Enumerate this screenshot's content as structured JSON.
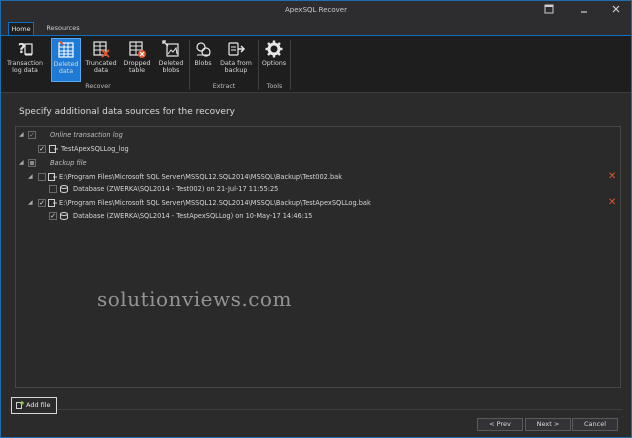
{
  "window": {
    "title": "ApexSQL Recover"
  },
  "tabs": [
    {
      "label": "Home",
      "active": true
    },
    {
      "label": "Resources",
      "active": false
    }
  ],
  "ribbon": {
    "groups": [
      {
        "label": "Recover"
      },
      {
        "label": "Extract"
      },
      {
        "label": "Tools"
      }
    ],
    "buttons": {
      "transaction_log": {
        "line1": "Transaction",
        "line2": "log data"
      },
      "deleted": {
        "line1": "Deleted",
        "line2": "data"
      },
      "truncated": {
        "line1": "Truncated",
        "line2": "data"
      },
      "dropped": {
        "line1": "Dropped",
        "line2": "table"
      },
      "deleted_blobs": {
        "line1": "Deleted",
        "line2": "blobs"
      },
      "blobs": {
        "line1": "Blobs",
        "line2": ""
      },
      "data_backup": {
        "line1": "Data from",
        "line2": "backup"
      },
      "options": {
        "line1": "Options",
        "line2": ""
      }
    }
  },
  "main": {
    "heading": "Specify additional data sources for the recovery",
    "tree": {
      "online_log": {
        "label": "Online transaction log",
        "children": [
          {
            "label": "TestApexSQLLog_log",
            "checked": true
          }
        ]
      },
      "backup": {
        "label": "Backup file",
        "files": [
          {
            "path": "E:\\Program Files\\Microsoft SQL Server\\MSSQL12.SQL2014\\MSSQL\\Backup\\Test002.bak",
            "checked": false,
            "db": "Database (ZWERKA\\SQL2014 - Test002) on 21-Jul-17 11:55:25",
            "db_checked": false
          },
          {
            "path": "E:\\Program Files\\Microsoft SQL Server\\MSSQL12.SQL2014\\MSSQL\\Backup\\TestApexSQLLog.bak",
            "checked": true,
            "db": "Database (ZWERKA\\SQL2014 - TestApexSQLLog) on 10-May-17 14:46:15",
            "db_checked": true
          }
        ]
      }
    }
  },
  "watermark": "solutionviews.com",
  "footer": {
    "add_file": "Add file",
    "prev": "< Prev",
    "next": "Next >",
    "cancel": "Cancel"
  },
  "colors": {
    "accent": "#1f7ad6",
    "delete": "#e0562a",
    "background": "#2b2b2b"
  }
}
